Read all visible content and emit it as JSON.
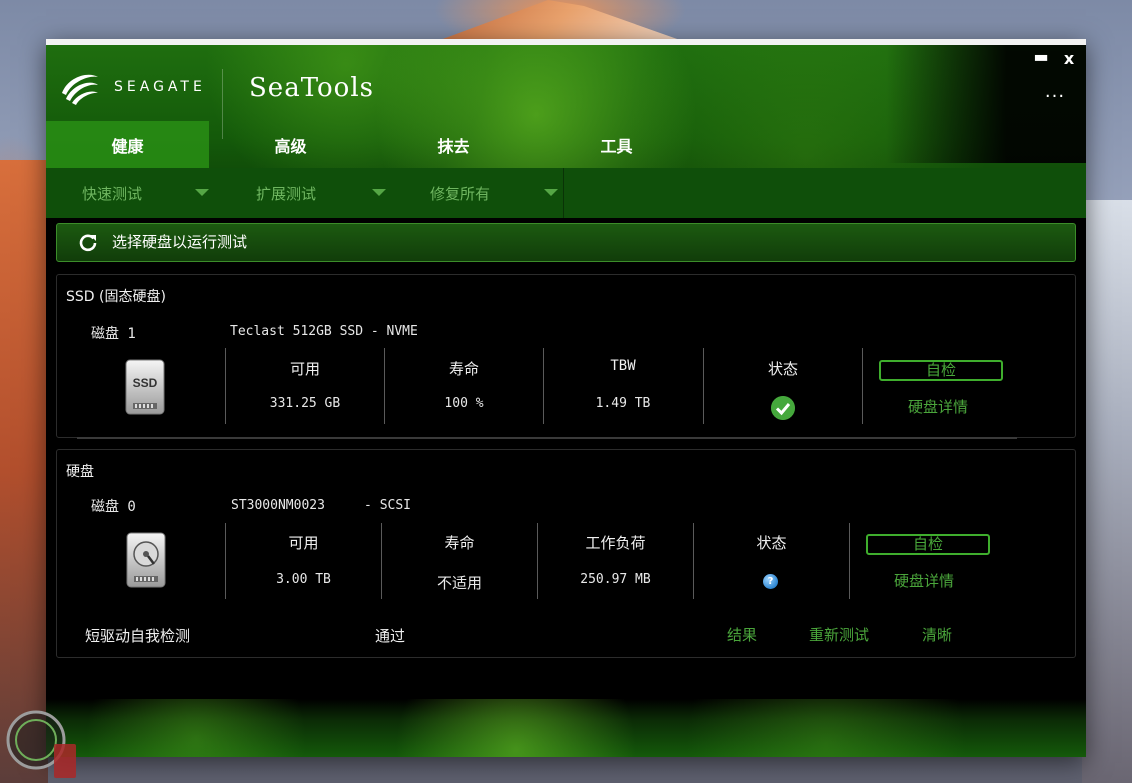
{
  "app": {
    "brand": "SEAGATE",
    "title": "SeaTools",
    "window_controls": {
      "minimize": "▬",
      "close": "x",
      "more": "..."
    }
  },
  "tabs": [
    {
      "label": "健康",
      "active": true
    },
    {
      "label": "高级",
      "active": false
    },
    {
      "label": "抹去",
      "active": false
    },
    {
      "label": "工具",
      "active": false
    }
  ],
  "subnav": [
    {
      "label": "快速测试"
    },
    {
      "label": "扩展测试"
    },
    {
      "label": "修复所有"
    }
  ],
  "action_bar": {
    "label": "选择硬盘以运行测试"
  },
  "sections": {
    "ssd": {
      "title": "SSD (固态硬盘)",
      "disk_label": "磁盘 1",
      "model": "Teclast 512GB SSD - NVME",
      "icon": "ssd-drive-icon",
      "icon_text": "SSD",
      "columns": [
        {
          "header": "可用",
          "value": "331.25 GB"
        },
        {
          "header": "寿命",
          "value": "100 %"
        },
        {
          "header": "TBW",
          "value": "1.49 TB"
        },
        {
          "header": "状态",
          "value": ""
        }
      ],
      "status_icon": "check-ok-icon",
      "self_test_label": "自检",
      "details_label": "硬盘详情"
    },
    "hdd": {
      "title": "硬盘",
      "disk_label": "磁盘 0",
      "model": "ST3000NM0023     - SCSI",
      "icon": "hdd-drive-icon",
      "columns": [
        {
          "header": "可用",
          "value": "3.00 TB"
        },
        {
          "header": "寿命",
          "value": "不适用"
        },
        {
          "header": "工作负荷",
          "value": "250.97 MB"
        },
        {
          "header": "状态",
          "value": ""
        }
      ],
      "status_icon": "question-icon",
      "status_icon_text": "?",
      "self_test_label": "自检",
      "details_label": "硬盘详情",
      "test_row": {
        "name": "短驱动自我检测",
        "result": "通过",
        "links": [
          "结果",
          "重新测试",
          "清晰"
        ]
      }
    }
  },
  "colors": {
    "accent_green": "#49a83a",
    "header_green": "#145a0a",
    "subnav_text": "#6fb660"
  }
}
